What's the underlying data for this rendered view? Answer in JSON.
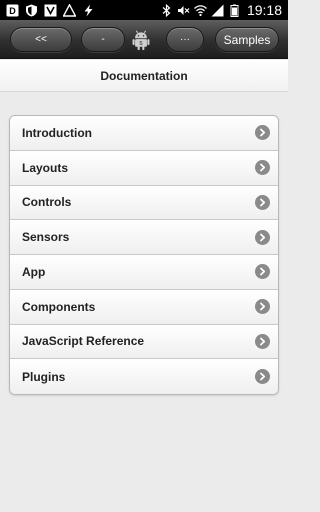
{
  "status_bar": {
    "time": "19:18",
    "left_icons": [
      "app-icon",
      "shield-icon",
      "usb-icon",
      "triangle-alert-icon",
      "charging-icon"
    ],
    "right_icons": [
      "bluetooth-icon",
      "mute-icon",
      "wifi-icon",
      "signal-icon",
      "battery-icon"
    ]
  },
  "toolbar": {
    "back_label": "<<",
    "middle_label": "-",
    "more_label": "···",
    "samples_label": "Samples",
    "logo_icon": "android-icon"
  },
  "header": {
    "title": "Documentation"
  },
  "list": {
    "items": [
      {
        "label": "Introduction"
      },
      {
        "label": "Layouts"
      },
      {
        "label": "Controls"
      },
      {
        "label": "Sensors"
      },
      {
        "label": "App"
      },
      {
        "label": "Components"
      },
      {
        "label": "JavaScript Reference"
      },
      {
        "label": "Plugins"
      }
    ],
    "chevron_icon": "chevron-right-icon"
  },
  "colors": {
    "toolbar": "#2f2f2f",
    "background": "#ebebeb",
    "chevron": "#8a8a8a"
  }
}
